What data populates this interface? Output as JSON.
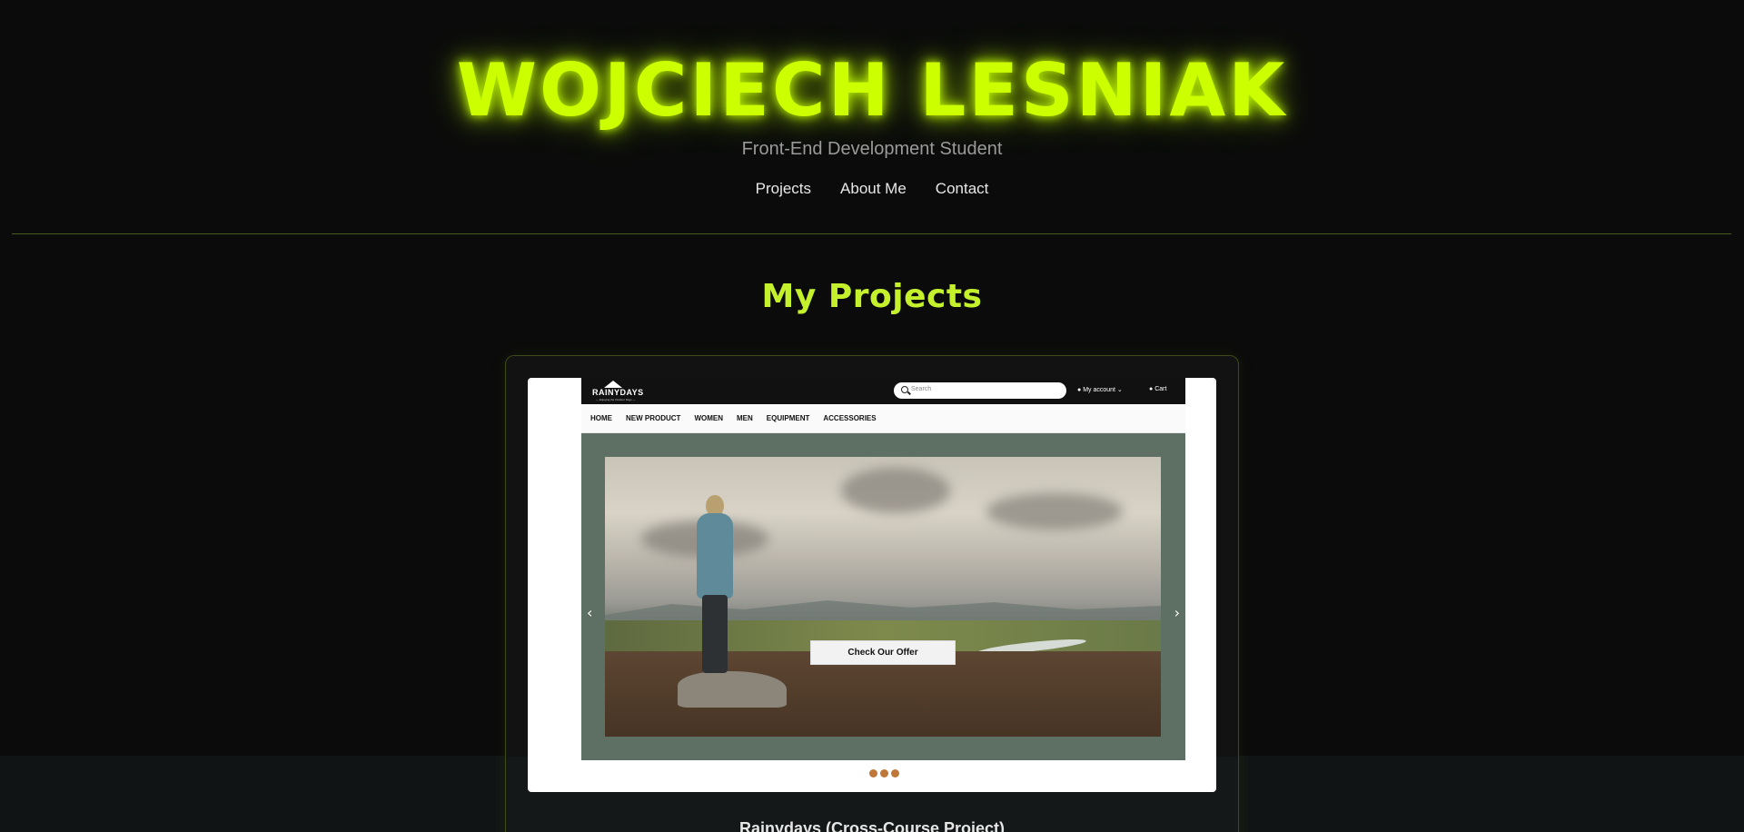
{
  "header": {
    "title": "WOJCIECH LESNIAK",
    "subtitle": "Front-End Development Student",
    "nav": [
      "Projects",
      "About Me",
      "Contact"
    ]
  },
  "projects_section": {
    "title": "My Projects",
    "project": {
      "title": "Rainydays (Cross-Course Project)",
      "preview": {
        "logo_text": "RAINYDAYS",
        "logo_tagline": "— Enjoying the Outdoor Days —",
        "search_placeholder": "Search",
        "account_label": "My account",
        "cart_label": "Cart",
        "nav": [
          "HOME",
          "NEW PRODUCT",
          "WOMEN",
          "MEN",
          "EQUIPMENT",
          "ACCESSORIES"
        ],
        "cta_label": "Check Our Offer",
        "prev_arrow": "‹",
        "next_arrow": "›",
        "slide_count": 3
      }
    }
  },
  "colors": {
    "accent": "#ccff00",
    "background": "#0b0b0b",
    "dot": "#c0783a"
  }
}
